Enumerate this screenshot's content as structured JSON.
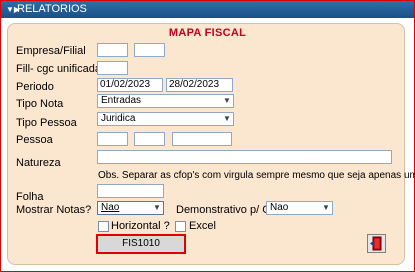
{
  "window": {
    "title": "RELATORIOS"
  },
  "form": {
    "section_title": "MAPA FISCAL",
    "labels": {
      "empresa": "Empresa/Filial",
      "filial_cgc": "Fill- cgc unificada",
      "periodo": "Periodo",
      "tipo_nota": "Tipo Nota",
      "tipo_pessoa": "Tipo Pessoa",
      "pessoa": "Pessoa",
      "natureza": "Natureza",
      "folha": "Folha",
      "mostrar_notas": "Mostrar Notas?",
      "demonstrativo": "Demonstrativo p/ GIA?",
      "horizontal": "Horizontal ?",
      "excel": "Excel"
    },
    "fields": {
      "periodo_inicio": "01/02/2023",
      "periodo_fim": "28/02/2023",
      "tipo_nota": "Entradas",
      "tipo_pessoa": "Juridica",
      "mostrar_notas": "Nao",
      "demonstrativo": "Nao"
    },
    "obs": "Obs. Separar as cfop's com virgula sempre mesmo que seja  apenas uma",
    "button_label": "FIS1010"
  },
  "icons": {
    "title": "window-icon",
    "exit": "exit-door-icon"
  },
  "colors": {
    "title_bar": "#1f5a94",
    "panel": "#fbe6d0",
    "accent": "#c0001e",
    "focus_border": "#e00000"
  }
}
